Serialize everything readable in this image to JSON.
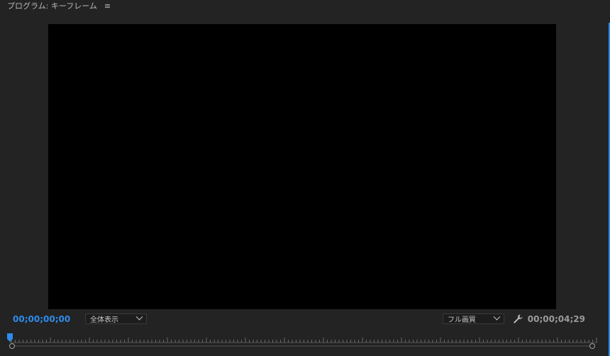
{
  "panel": {
    "title": "プログラム: キーフレーム",
    "menu_icon": "≡"
  },
  "viewer": {
    "current_timecode": "00;00;00;00",
    "duration_timecode": "00;00;04;29",
    "zoom_select": "全体表示",
    "quality_select": "フル画質"
  },
  "colors": {
    "accent": "#2d8ceb",
    "background": "#232323",
    "monitor": "#000000"
  },
  "icons": {
    "panel_menu": "hamburger-menu-icon",
    "settings": "wrench-icon",
    "playhead": "playhead-icon"
  }
}
